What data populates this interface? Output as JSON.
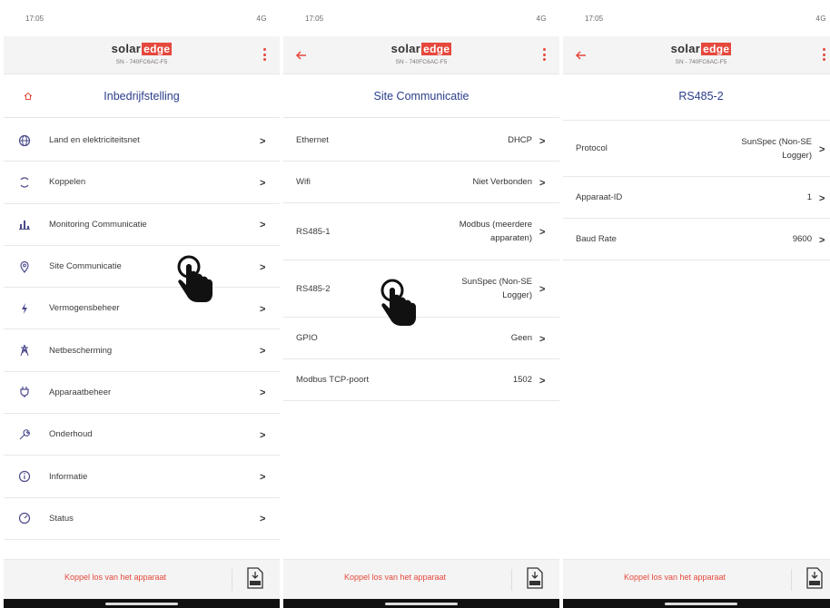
{
  "statusbar": {
    "time": "17:05",
    "signal": "4G"
  },
  "brand": {
    "logo_part1": "solar",
    "logo_part2": "edge",
    "serial": "SN - 740FC6AC-F5",
    "accent_color": "#e5483c",
    "title_color": "#2a3e8c"
  },
  "screen1": {
    "title": "Inbedrijfstelling",
    "items": [
      {
        "label": "Land en elektriciteitsnet",
        "icon": "globe-icon"
      },
      {
        "label": "Koppelen",
        "icon": "sync-icon"
      },
      {
        "label": "Monitoring Communicatie",
        "icon": "bar-chart-icon"
      },
      {
        "label": "Site Communicatie",
        "icon": "location-pin-icon"
      },
      {
        "label": "Vermogensbeheer",
        "icon": "lightning-icon"
      },
      {
        "label": "Netbescherming",
        "icon": "power-tower-icon"
      },
      {
        "label": "Apparaatbeheer",
        "icon": "plug-icon"
      },
      {
        "label": "Onderhoud",
        "icon": "wrench-icon"
      },
      {
        "label": "Informatie",
        "icon": "info-icon"
      },
      {
        "label": "Status",
        "icon": "gauge-icon"
      }
    ]
  },
  "screen2": {
    "title": "Site Communicatie",
    "items": [
      {
        "label": "Ethernet",
        "value": "DHCP"
      },
      {
        "label": "Wifi",
        "value": "Niet Verbonden"
      },
      {
        "label": "RS485-1",
        "value_line1": "Modbus (meerdere",
        "value_line2": "apparaten)"
      },
      {
        "label": "RS485-2",
        "value_line1": "SunSpec (Non-SE",
        "value_line2": "Logger)"
      },
      {
        "label": "GPIO",
        "value": "Geen"
      },
      {
        "label": "Modbus TCP-poort",
        "value": "1502"
      }
    ]
  },
  "screen3": {
    "title": "RS485-2",
    "items": [
      {
        "label": "Protocol",
        "value_line1": "SunSpec (Non-SE",
        "value_line2": "Logger)"
      },
      {
        "label": "Apparaat-ID",
        "value": "1"
      },
      {
        "label": "Baud Rate",
        "value": "9600"
      }
    ]
  },
  "footer": {
    "disconnect_label": "Koppel los van het apparaat",
    "export_icon": "jpg-export-icon"
  },
  "chevron": ">"
}
